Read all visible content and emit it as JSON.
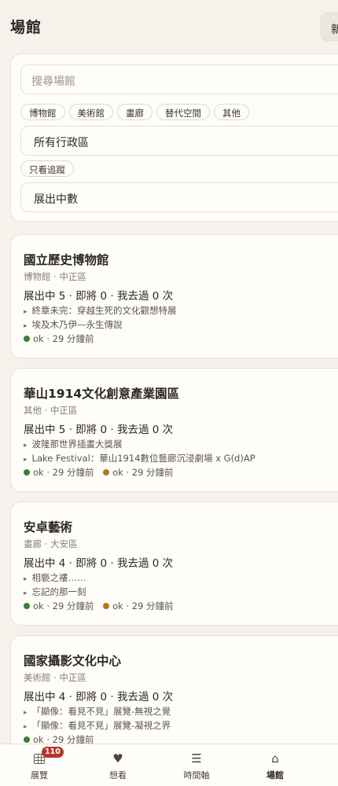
{
  "header": {
    "title": "場館",
    "new_button_label": "新"
  },
  "filters": {
    "search_placeholder": "搜尋場館",
    "categories": [
      "博物館",
      "美術館",
      "畫廊",
      "替代空間",
      "其他"
    ],
    "district_value": "所有行政區",
    "follow_only_label": "只看追蹤",
    "sort_value": "展出中數"
  },
  "venues": [
    {
      "name": "國立歷史博物館",
      "meta": "博物館 · 中正區",
      "stats": "展出中 5 · 即將 0 · 我去過 0 次",
      "exhibits": [
        "終章未完：穿越生死的文化觀想特展",
        "埃及木乃伊—永生傳說"
      ],
      "statuses": [
        {
          "text": "ok · 29 分鐘前",
          "color": "#3a7d3a"
        }
      ]
    },
    {
      "name": "華山1914文化創意產業園區",
      "meta": "其他 · 中正區",
      "stats": "展出中 5 · 即將 0 · 我去過 0 次",
      "exhibits": [
        "波隆那世界插畫大獎展",
        "Lake Festival：華山1914數位藝廊沉浸劇場 x G(d)AP"
      ],
      "statuses": [
        {
          "text": "ok · 29 分鐘前",
          "color": "#3a7d3a"
        },
        {
          "text": "ok · 29 分鐘前",
          "color": "#b27a12"
        }
      ]
    },
    {
      "name": "安卓藝術",
      "meta": "畫廊 · 大安區",
      "stats": "展出中 4 · 即將 0 · 我去過 0 次",
      "exhibits": [
        "相褻之褸……",
        "忘記的那一刻"
      ],
      "statuses": [
        {
          "text": "ok · 29 分鐘前",
          "color": "#3a7d3a"
        },
        {
          "text": "ok · 29 分鐘前",
          "color": "#b27a12"
        }
      ]
    },
    {
      "name": "國家攝影文化中心",
      "meta": "美術館 · 中正區",
      "stats": "展出中 4 · 即將 0 · 我去過 0 次",
      "exhibits": [
        "「顯像：看見不見」展覽-無視之覺",
        "「顯像：看見不見」展覽-凝視之界"
      ],
      "statuses": [
        {
          "text": "ok · 29 分鐘前",
          "color": "#3a7d3a"
        }
      ]
    }
  ],
  "nav": {
    "items": [
      {
        "label": "展覽",
        "icon": "grid-icon",
        "badge": "110"
      },
      {
        "label": "想看",
        "icon": "heart-icon",
        "glyph": "♥"
      },
      {
        "label": "時間軸",
        "icon": "list-icon",
        "glyph": "☰"
      },
      {
        "label": "場館",
        "icon": "home-icon",
        "glyph": "⌂"
      }
    ]
  }
}
